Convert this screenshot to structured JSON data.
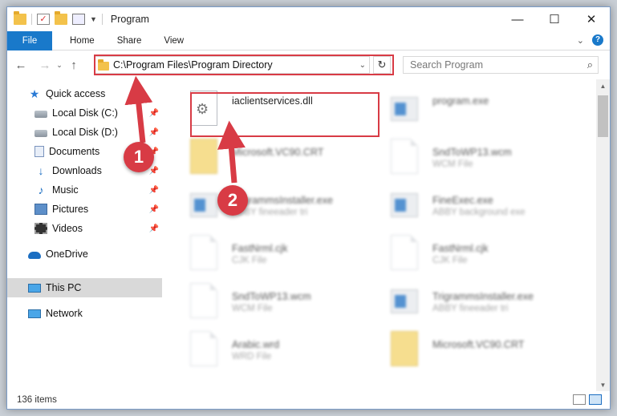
{
  "window": {
    "title": "Program",
    "controls": {
      "minimize": "—",
      "maximize": "☐",
      "close": "✕"
    }
  },
  "ribbon": {
    "tabs": [
      "File",
      "Home",
      "Share",
      "View"
    ],
    "help": "?"
  },
  "address": {
    "path": "C:\\Program Files\\Program Directory",
    "search_placeholder": "Search Program"
  },
  "sidebar": {
    "items": [
      {
        "label": "Quick access",
        "icon": "star-icon",
        "pinned": false
      },
      {
        "label": "Local Disk (C:)",
        "icon": "drive-icon",
        "pinned": true
      },
      {
        "label": "Local Disk (D:)",
        "icon": "drive-icon",
        "pinned": true
      },
      {
        "label": "Documents",
        "icon": "documents-icon",
        "pinned": true
      },
      {
        "label": "Downloads",
        "icon": "download-icon",
        "pinned": true
      },
      {
        "label": "Music",
        "icon": "music-icon",
        "pinned": true
      },
      {
        "label": "Pictures",
        "icon": "pictures-icon",
        "pinned": true
      },
      {
        "label": "Videos",
        "icon": "videos-icon",
        "pinned": true
      },
      {
        "label": "OneDrive",
        "icon": "cloud-icon",
        "pinned": false
      },
      {
        "label": "This PC",
        "icon": "computer-icon",
        "pinned": false,
        "selected": true
      },
      {
        "label": "Network",
        "icon": "network-icon",
        "pinned": false
      }
    ]
  },
  "files": [
    {
      "name": "iaclientservices.dll",
      "type": "",
      "kind": "dll",
      "highlighted": true
    },
    {
      "name": "program.exe",
      "type": "",
      "kind": "exe"
    },
    {
      "name": "Microsoft.VC90.CRT",
      "type": "",
      "kind": "folder"
    },
    {
      "name": "SndToWP13.wcm",
      "type": "WCM File",
      "kind": "doc"
    },
    {
      "name": "TrigrammsInstaller.exe",
      "type": "ABBY fineeader tri",
      "kind": "exe"
    },
    {
      "name": "FineExec.exe",
      "type": "ABBY background exe",
      "kind": "exe"
    },
    {
      "name": "FastNrml.cjk",
      "type": "CJK File",
      "kind": "doc"
    },
    {
      "name": "FastNrml.cjk",
      "type": "CJK File",
      "kind": "doc"
    },
    {
      "name": "SndToWP13.wcm",
      "type": "WCM File",
      "kind": "doc"
    },
    {
      "name": "TrigrammsInstaller.exe",
      "type": "ABBY fineeader tri",
      "kind": "exe"
    },
    {
      "name": "Arabic.wrd",
      "type": "WRD File",
      "kind": "doc"
    },
    {
      "name": "Microsoft.VC90.CRT",
      "type": "",
      "kind": "folder"
    }
  ],
  "status": {
    "item_count": "136 items"
  },
  "callouts": [
    "1",
    "2"
  ],
  "colors": {
    "accent": "#1979ca",
    "highlight": "#d83b45",
    "selected_nav": "#d9d9d9"
  }
}
